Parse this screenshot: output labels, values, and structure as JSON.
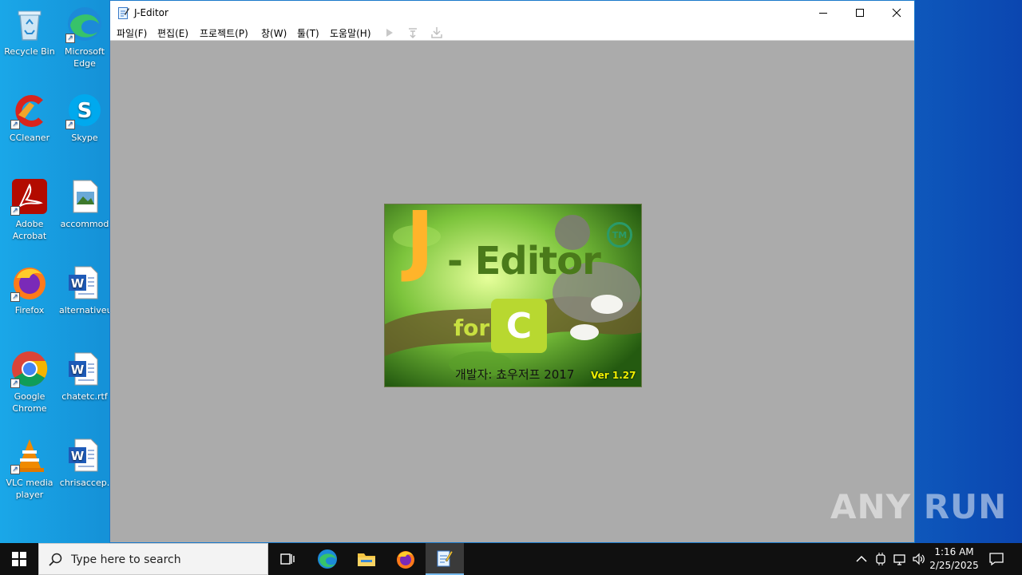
{
  "desktop": {
    "icons": [
      {
        "label": "Recycle Bin"
      },
      {
        "label": "Microsoft Edge"
      },
      {
        "label": "CCleaner"
      },
      {
        "label": "Skype"
      },
      {
        "label": "Adobe Acrobat"
      },
      {
        "label": "accommod"
      },
      {
        "label": "Firefox"
      },
      {
        "label": "alternativeu"
      },
      {
        "label": "Google Chrome"
      },
      {
        "label": "chatetc.rtf"
      },
      {
        "label": "VLC media player"
      },
      {
        "label": "chrisaccep."
      }
    ]
  },
  "window": {
    "title": "J-Editor",
    "menu": [
      "파일(F)",
      "편집(E)",
      "프로젝트(P)",
      "창(W)",
      "툴(T)",
      "도움말(H)"
    ]
  },
  "splash": {
    "logo_j": "J",
    "logo_editor": "- Editor",
    "tm": "TM",
    "for": "for",
    "c_letter": "C",
    "developer": "개발자: 쵸우저프 2017",
    "version": "Ver 1.27"
  },
  "taskbar": {
    "search_placeholder": "Type here to search",
    "time": "1:16 AM",
    "date": "2/25/2025"
  },
  "watermark": "ANY RUN",
  "colors": {
    "desktop_blue": "#1592d8",
    "window_bg": "#ababab",
    "taskbar": "#101010",
    "editor_green": "#4a7a1a",
    "version_yellow": "#f0f000"
  }
}
